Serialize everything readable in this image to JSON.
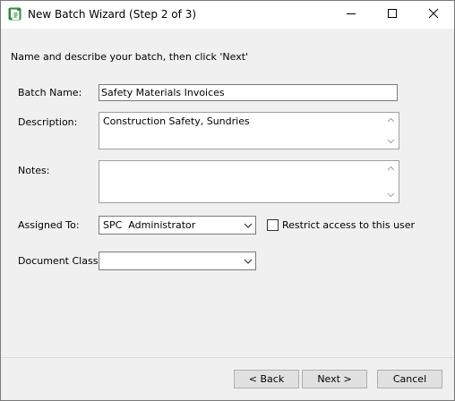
{
  "window": {
    "title": "New Batch Wizard (Step 2 of 3)"
  },
  "instruction": "Name and describe your batch, then click 'Next'",
  "form": {
    "batch_name": {
      "label": "Batch Name:",
      "value": "Safety Materials Invoices"
    },
    "description": {
      "label": "Description:",
      "value": "Construction Safety, Sundries"
    },
    "notes": {
      "label": "Notes:",
      "value": ""
    },
    "assigned_to": {
      "label": "Assigned To:",
      "value": "SPC  Administrator"
    },
    "restrict_access": {
      "label": "Restrict access to this user",
      "checked": false
    },
    "document_class": {
      "label": "Document Class:",
      "value": ""
    }
  },
  "buttons": {
    "back": "< Back",
    "next": "Next >",
    "cancel": "Cancel"
  },
  "icons": {
    "app": "batch-document-icon",
    "minimize": "minimize-icon",
    "maximize": "maximize-icon",
    "close": "close-icon",
    "dropdown": "chevron-down-icon",
    "scroll_up": "scroll-up-icon",
    "scroll_down": "scroll-down-icon"
  },
  "colors": {
    "app_icon_green": "#2e8b3a",
    "window_bg": "#f0f0f0",
    "titlebar_bg": "#ffffff"
  }
}
